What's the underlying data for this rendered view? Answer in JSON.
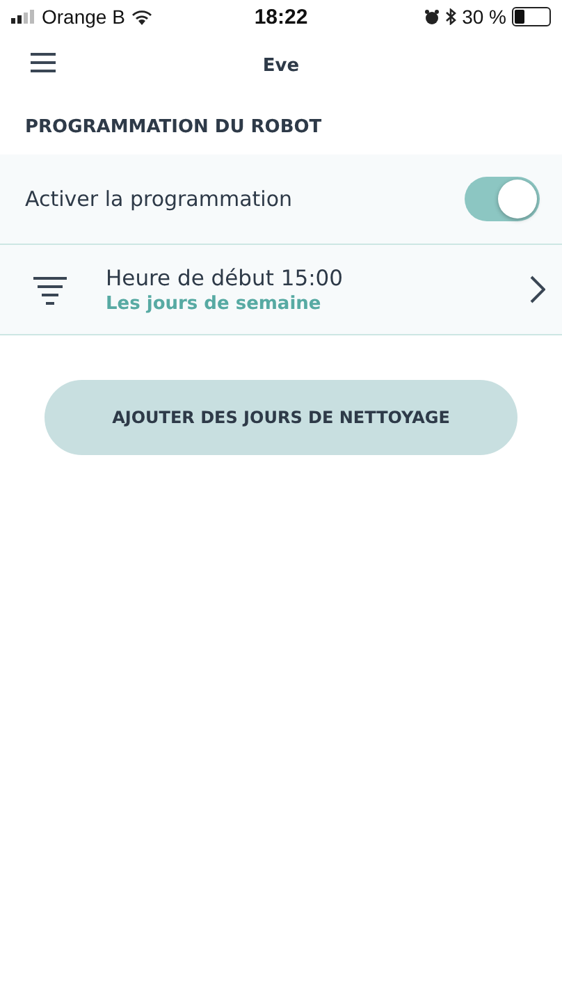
{
  "status_bar": {
    "carrier": "Orange B",
    "time": "18:22",
    "battery": "30 %"
  },
  "header": {
    "title": "Eve"
  },
  "section": {
    "title": "PROGRAMMATION DU ROBOT"
  },
  "toggle_row": {
    "label": "Activer la programmation",
    "on": true
  },
  "schedules": [
    {
      "title": "Heure de début 15:00",
      "subtitle": "Les jours de semaine"
    }
  ],
  "add_button": "AJOUTER DES JOURS DE NETTOYAGE"
}
